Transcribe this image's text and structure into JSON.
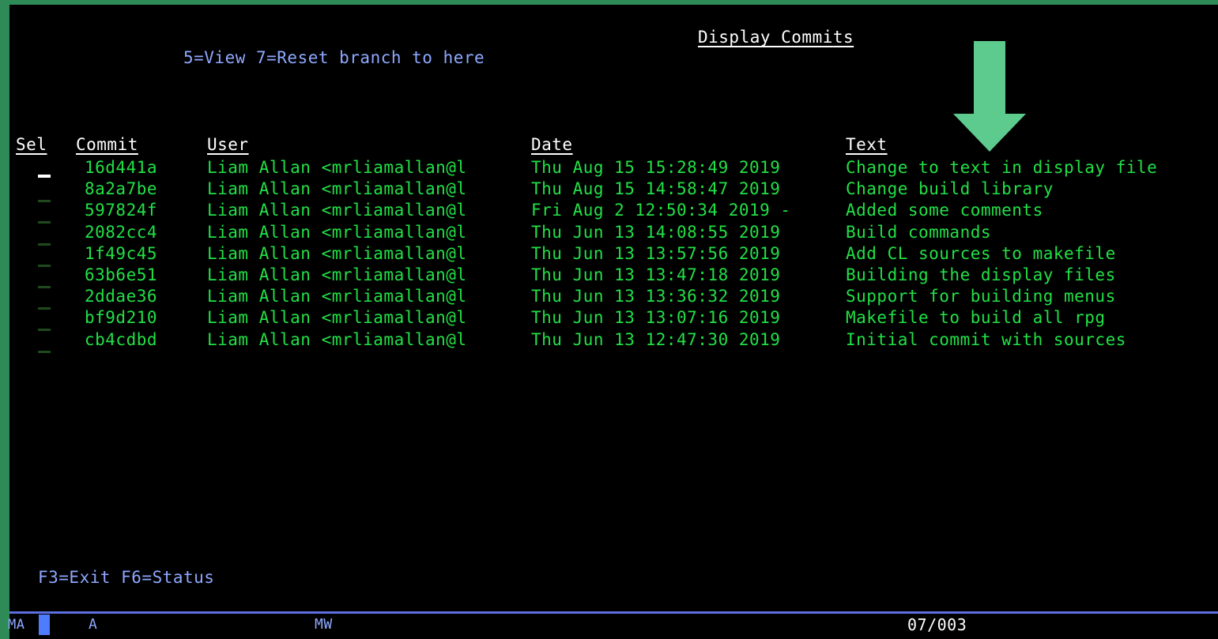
{
  "screen": {
    "title": "Display Commits",
    "options": "5=View 7=Reset branch to here",
    "function_keys": "F3=Exit F6=Status"
  },
  "columns": {
    "sel": "Sel",
    "commit": "Commit",
    "user": "User",
    "date": "Date",
    "text": "Text"
  },
  "rows": [
    {
      "commit": "16d441a",
      "user": "Liam Allan <mrliamallan@l",
      "date": "Thu Aug 15 15:28:49 2019",
      "text": "Change to text in display file"
    },
    {
      "commit": "8a2a7be",
      "user": "Liam Allan <mrliamallan@l",
      "date": "Thu Aug 15 14:58:47 2019",
      "text": "Change build library"
    },
    {
      "commit": "597824f",
      "user": "Liam Allan <mrliamallan@l",
      "date": "Fri Aug 2 12:50:34 2019 -",
      "text": "Added some comments"
    },
    {
      "commit": "2082cc4",
      "user": "Liam Allan <mrliamallan@l",
      "date": "Thu Jun 13 14:08:55 2019",
      "text": "Build commands"
    },
    {
      "commit": "1f49c45",
      "user": "Liam Allan <mrliamallan@l",
      "date": "Thu Jun 13 13:57:56 2019",
      "text": "Add CL sources to makefile"
    },
    {
      "commit": "63b6e51",
      "user": "Liam Allan <mrliamallan@l",
      "date": "Thu Jun 13 13:47:18 2019",
      "text": "Building the display files"
    },
    {
      "commit": "2ddae36",
      "user": "Liam Allan <mrliamallan@l",
      "date": "Thu Jun 13 13:36:32 2019",
      "text": "Support for building menus"
    },
    {
      "commit": "bf9d210",
      "user": "Liam Allan <mrliamallan@l",
      "date": "Thu Jun 13 13:07:16 2019",
      "text": "Makefile to build all rpg"
    },
    {
      "commit": "cb4cdbd",
      "user": "Liam Allan <mrliamallan@l",
      "date": "Thu Jun 13 12:47:30 2019",
      "text": "Initial commit with sources"
    }
  ],
  "status_bar": {
    "left": "MA",
    "indicator_a": "A",
    "mw": "MW",
    "position": "07/003"
  },
  "annotation": {
    "icon": "down-arrow-icon",
    "color": "#5ecb8e"
  }
}
